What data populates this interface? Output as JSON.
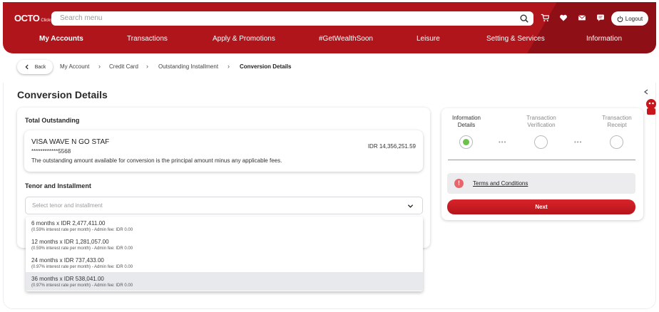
{
  "header": {
    "logo_main": "OCTO",
    "logo_sub": "Clicks",
    "search_placeholder": "Search menu",
    "logout_label": "Logout",
    "nav": [
      {
        "label": "My Accounts",
        "active": true
      },
      {
        "label": "Transactions"
      },
      {
        "label": "Apply & Promotions"
      },
      {
        "label": "#GetWealthSoon"
      },
      {
        "label": "Leisure"
      },
      {
        "label": "Setting & Services"
      },
      {
        "label": "Information"
      }
    ]
  },
  "breadcrumb": {
    "back_label": "Back",
    "items": [
      "My Account",
      "Credit Card",
      "Outstanding Installment",
      "Conversion Details"
    ]
  },
  "page": {
    "title": "Conversion Details"
  },
  "outstanding": {
    "label": "Total Outstanding",
    "card_name": "VISA WAVE N GO STAF",
    "card_number": "************5568",
    "amount": "IDR 14,356,251.59",
    "note": "The outstanding amount available for conversion is the principal amount minus any applicable fees."
  },
  "tenor": {
    "label": "Tenor and Installment",
    "placeholder": "Select tenor and installment",
    "options": [
      {
        "title": "6 months x IDR 2,477,411.00",
        "detail": "(0.59% interest rate per month) - Admin fee: IDR 0.00"
      },
      {
        "title": "12 months x IDR 1,281,057.00",
        "detail": "(0.59% interest rate per month) - Admin fee: IDR 0.00"
      },
      {
        "title": "24 months x IDR 737,433.00",
        "detail": "(0.97% interest rate per month) - Admin fee: IDR 0.00"
      },
      {
        "title": "36 months x IDR 538,041.00",
        "detail": "(0.97% interest rate per month) - Admin fee: IDR 0.00"
      }
    ]
  },
  "steps": [
    {
      "line1": "Information",
      "line2": "Details",
      "active": true
    },
    {
      "line1": "Transaction",
      "line2": "Verification",
      "active": false
    },
    {
      "line1": "Transaction",
      "line2": "Receipt",
      "active": false
    }
  ],
  "terms_label": "Terms and Conditions",
  "next_label": "Next",
  "colors": {
    "brand_red": "#b0151c",
    "active_step": "#6cc24a",
    "warning_icon": "#e8666b"
  }
}
